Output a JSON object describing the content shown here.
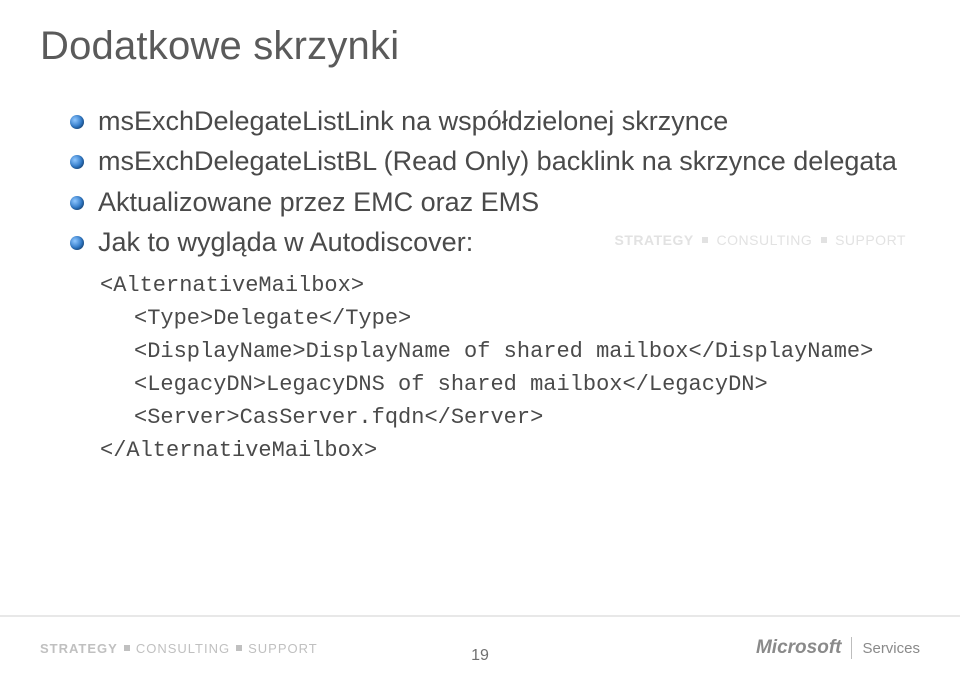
{
  "title": "Dodatkowe skrzynki",
  "bullets": [
    "msExchDelegateListLink na współdzielonej skrzynce",
    "msExchDelegateListBL (Read Only) backlink na skrzynce delegata",
    "Aktualizowane przez EMC oraz EMS",
    "Jak to wygląda w Autodiscover:"
  ],
  "code": {
    "l1": "<AlternativeMailbox>",
    "l2": "<Type>Delegate</Type>",
    "l3": "<DisplayName>DisplayName of shared mailbox</DisplayName>",
    "l4": "<LegacyDN>LegacyDNS of shared mailbox</LegacyDN>",
    "l5": "<Server>CasServer.fqdn</Server>",
    "l6": "</AlternativeMailbox>"
  },
  "watermark": {
    "w1": "STRATEGY",
    "w2": "CONSULTING",
    "w3": "SUPPORT"
  },
  "footer": {
    "left": {
      "w1": "STRATEGY",
      "w2": "CONSULTING",
      "w3": "SUPPORT"
    },
    "page": "19",
    "right": {
      "brand": "Microsoft",
      "suffix": "Services"
    }
  }
}
